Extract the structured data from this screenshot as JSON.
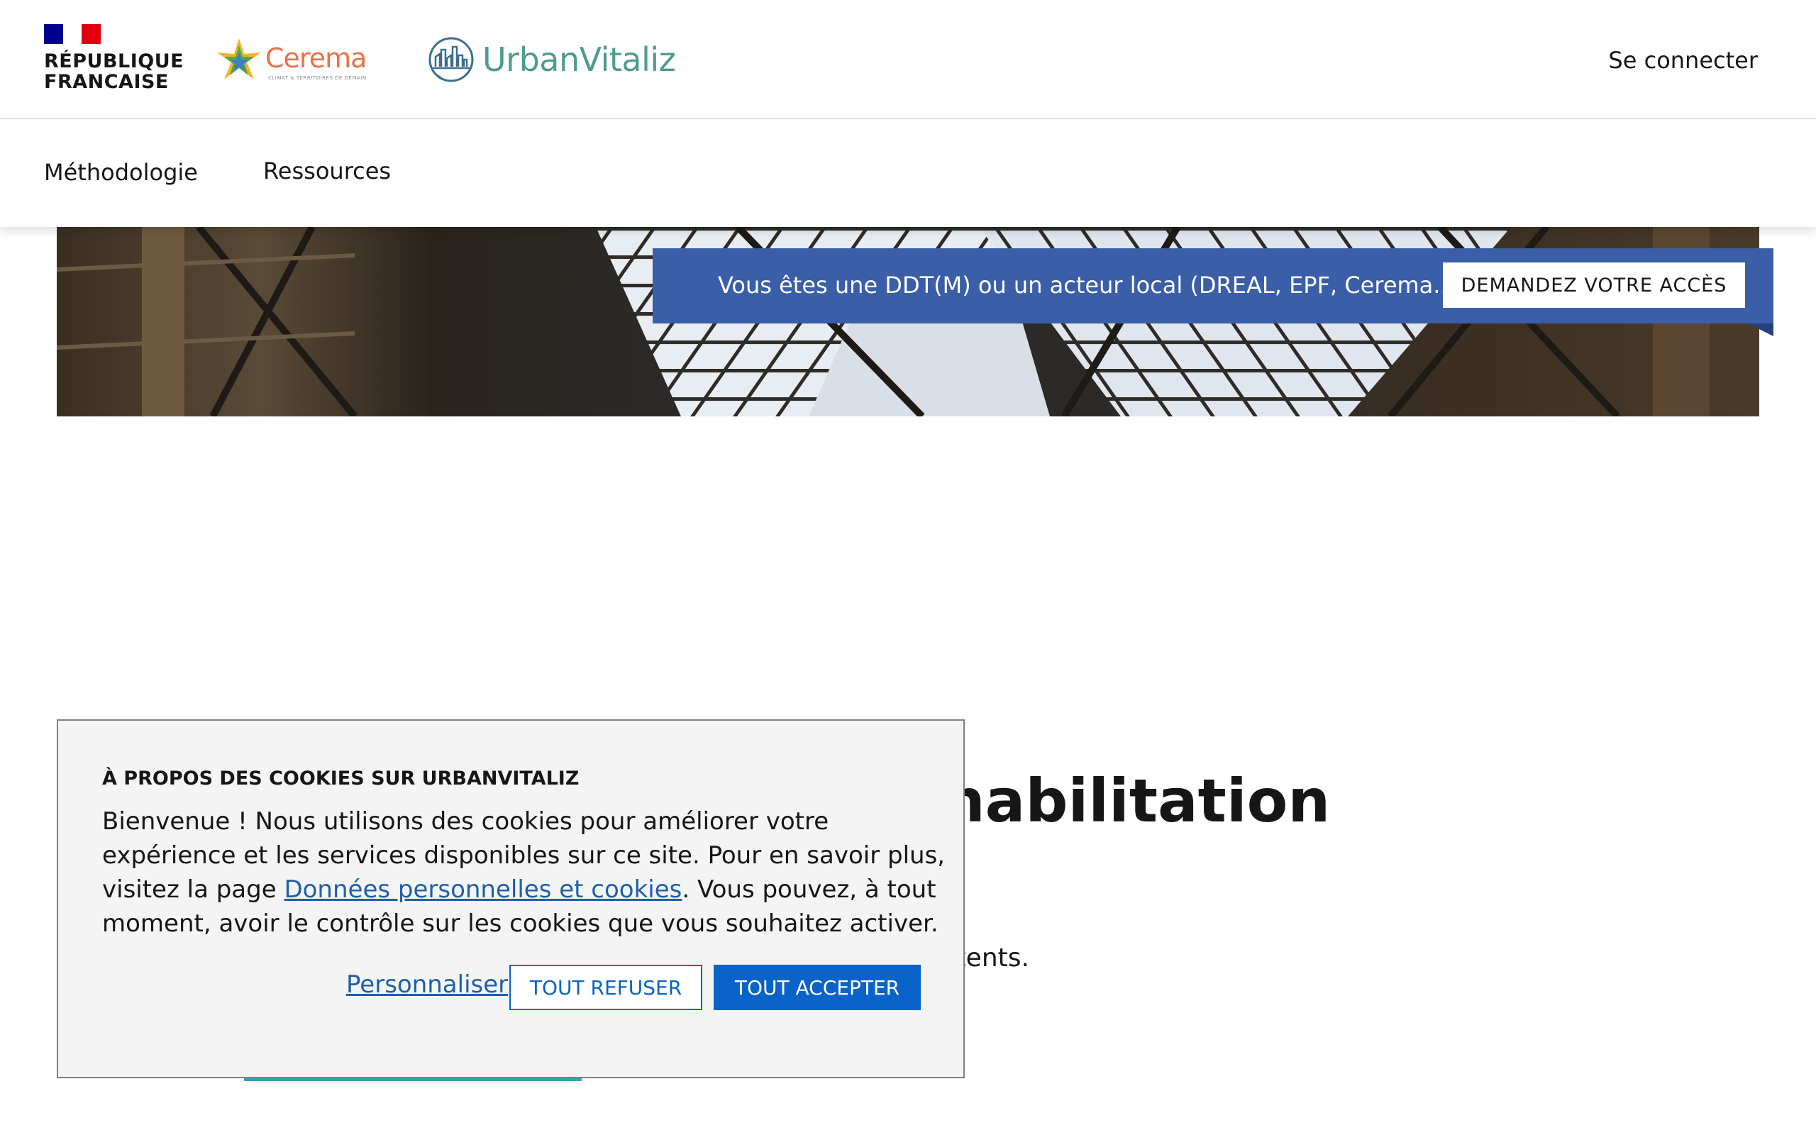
{
  "header": {
    "gov_logo_text": "RÉPUBLIQUE\nFRANCAISE",
    "cerema_name": "Cerema",
    "cerema_tagline": "CLIMAT & TERRITOIRES DE DEMAIN",
    "app_name": "UrbanVitaliz",
    "login_label": "Se connecter"
  },
  "nav": {
    "items": [
      {
        "label": "Méthodologie"
      },
      {
        "label": "Ressources"
      }
    ]
  },
  "banner": {
    "text": "Vous êtes une DDT(M) ou un acteur local (DREAL, EPF, Cerema...) ?",
    "button_label": "DEMANDEZ VOTRE ACCÈS"
  },
  "main": {
    "title_visible": "ans la réhabilitation",
    "subtitle_visible": "illers publics compétents."
  },
  "cookie_modal": {
    "title": "À PROPOS DES COOKIES SUR URBANVITALIZ",
    "text_before_link": "Bienvenue ! Nous utilisons des cookies pour améliorer votre expérience et les services disponibles sur ce site. Pour en savoir plus, visitez la page ",
    "link_label": "Données personnelles et cookies",
    "text_after_link": ". Vous pouvez, à tout moment, avoir le contrôle sur les cookies que vous souhaitez activer.",
    "customize_label": "Personnaliser",
    "refuse_label": "TOUT REFUSER",
    "accept_label": "TOUT ACCEPTER"
  },
  "colors": {
    "banner_blue": "#3a5ea8",
    "accept_blue": "#0a63c8",
    "link_blue": "#1f5fa8",
    "brand_teal": "#4f9b8f",
    "cerema_orange": "#e8734a",
    "accent_teal": "#2ea8b0"
  }
}
